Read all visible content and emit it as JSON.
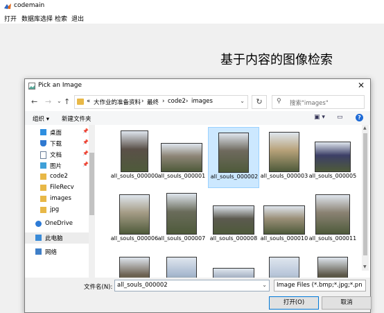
{
  "window": {
    "title": "codemain"
  },
  "menu": [
    "打开",
    "数据库选择",
    "检索",
    "退出"
  ],
  "main": {
    "heading": "基于内容的图像检索"
  },
  "dialog": {
    "title": "Pick an Image",
    "address": {
      "crumbs": [
        "«",
        "大作业的准备资料",
        "›",
        "最终",
        "›",
        "code2",
        "›",
        "images"
      ]
    },
    "search_placeholder": "搜索\"images\"",
    "toolbar": {
      "organize": "组织 ▾",
      "new_folder": "新建文件夹"
    },
    "nav_items": [
      {
        "label": "桌面",
        "icon": "desktop-icon",
        "pinned": true
      },
      {
        "label": "下载",
        "icon": "download-icon",
        "pinned": true
      },
      {
        "label": "文档",
        "icon": "document-icon",
        "pinned": true
      },
      {
        "label": "图片",
        "icon": "picture-icon",
        "pinned": true
      },
      {
        "label": "code2",
        "icon": "folder-icon",
        "pinned": false
      },
      {
        "label": "FileRecv",
        "icon": "folder-icon",
        "pinned": false
      },
      {
        "label": "images",
        "icon": "folder-icon",
        "pinned": false
      },
      {
        "label": "jpg",
        "icon": "folder-icon",
        "pinned": false
      },
      {
        "label": "OneDrive",
        "icon": "cloud-icon",
        "pinned": false
      },
      {
        "label": "此电脑",
        "icon": "computer-icon",
        "pinned": false,
        "selected": true
      },
      {
        "label": "网络",
        "icon": "network-icon",
        "pinned": false
      }
    ],
    "files": [
      {
        "name": "all_souls_000000",
        "color": "#5a5048"
      },
      {
        "name": "all_souls_000001",
        "color": "#8d8576"
      },
      {
        "name": "all_souls_000002",
        "color": "#6f6a5e",
        "selected": true
      },
      {
        "name": "all_souls_000003",
        "color": "#b8a27a"
      },
      {
        "name": "all_souls_000005",
        "color": "#3c3f66"
      },
      {
        "name": "all_souls_000006",
        "color": "#a59c86"
      },
      {
        "name": "all_souls_000007",
        "color": "#6a6c5b"
      },
      {
        "name": "all_souls_000008",
        "color": "#5c5a50"
      },
      {
        "name": "all_souls_000010",
        "color": "#9a8f78"
      },
      {
        "name": "all_souls_000011",
        "color": "#8a8273"
      },
      {
        "name": "",
        "color": "#6d6252"
      },
      {
        "name": "",
        "color": "#a7b8cf"
      },
      {
        "name": "",
        "color": "#8c9bb0"
      },
      {
        "name": "",
        "color": "#b7c5d9"
      },
      {
        "name": "",
        "color": "#5d5849"
      }
    ],
    "filename_label": "文件名(N):",
    "filename_value": "all_souls_000002",
    "filetype_value": "Image Files (*.bmp;*.jpg;*.pn",
    "open_button": "打开(O)",
    "cancel_button": "取消"
  }
}
